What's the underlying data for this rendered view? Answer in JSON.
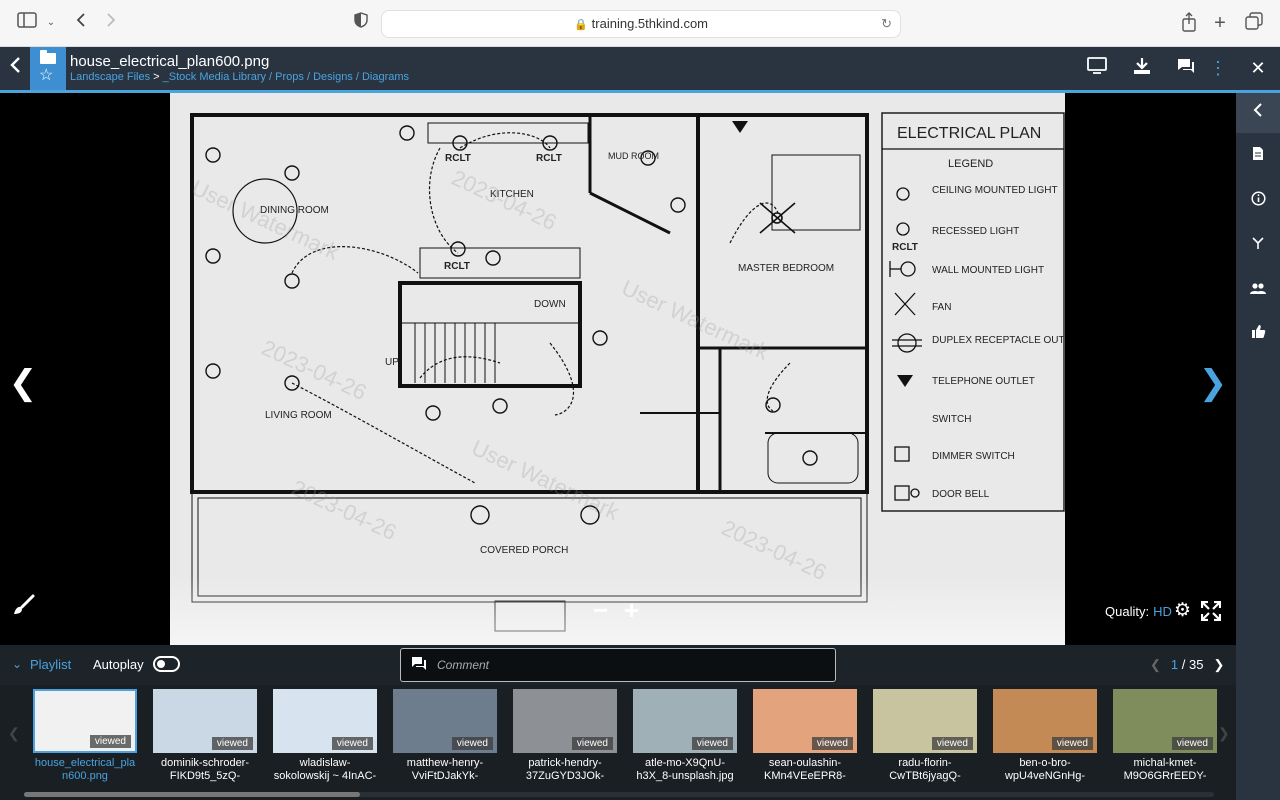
{
  "browser": {
    "url": "training.5thkind.com",
    "icons": [
      "sidebar-icon",
      "chevron-down-icon",
      "back-icon",
      "forward-icon",
      "shield-icon",
      "lock-icon",
      "reload-icon",
      "share-icon",
      "plus-icon",
      "tabs-icon"
    ]
  },
  "header": {
    "file_name": "house_electrical_plan600.png",
    "breadcrumb_root": "Landscape Files",
    "breadcrumb_sep": ">",
    "breadcrumb_path": "_Stock Media Library / Props / Designs / Diagrams",
    "icons": [
      "monitor-icon",
      "download-icon",
      "comments-icon",
      "more-icon",
      "close-icon"
    ]
  },
  "rail": {
    "icons": [
      "collapse-icon",
      "document-icon",
      "info-icon",
      "branch-icon",
      "users-icon",
      "like-icon"
    ]
  },
  "plan": {
    "title": "ELECTRICAL PLAN",
    "legend_title": "LEGEND",
    "legend": [
      "CEILING MOUNTED LIGHT",
      "RECESSED LIGHT",
      "WALL MOUNTED LIGHT",
      "FAN",
      "DUPLEX RECEPTACLE OUTLET",
      "TELEPHONE OUTLET",
      "SWITCH",
      "DIMMER SWITCH",
      "DOOR BELL"
    ],
    "rooms": [
      "DINING ROOM",
      "KITCHEN",
      "MUD ROOM",
      "MASTER BEDROOM",
      "LIVING ROOM",
      "COVERED PORCH"
    ],
    "stair_down": "DOWN",
    "stair_up": "UP",
    "rclt": "RCLT",
    "watermark_date": "2023-04-26",
    "watermark_user": "User Watermark"
  },
  "viewer": {
    "prev": "❮",
    "next": "❯",
    "zoom_out": "−",
    "zoom_in": "+",
    "quality_label": "Quality:",
    "quality_value": "HD"
  },
  "controls": {
    "playlist": "Playlist",
    "autoplay": "Autoplay",
    "comment_placeholder": "Comment",
    "page_current": "1",
    "page_total": "/ 35"
  },
  "thumbnails": [
    {
      "label1": "house_electrical_pla",
      "label2": "n600.png",
      "viewed": "viewed",
      "bg": "#f1f1f1"
    },
    {
      "label1": "dominik-schroder-",
      "label2": "FIKD9t5_5zQ-",
      "viewed": "viewed",
      "bg": "#c9d8e4"
    },
    {
      "label1": "wladislaw-",
      "label2": "sokolowskij ~ 4InAC-",
      "viewed": "viewed",
      "bg": "#d7e4ef"
    },
    {
      "label1": "matthew-henry-",
      "label2": "VviFtDJakYk-",
      "viewed": "viewed",
      "bg": "#6e7d8e"
    },
    {
      "label1": "patrick-hendry-",
      "label2": "37ZuGYD3JOk-",
      "viewed": "viewed",
      "bg": "#8d9196"
    },
    {
      "label1": "atle-mo-X9QnU-",
      "label2": "h3X_8-unsplash.jpg",
      "viewed": "viewed",
      "bg": "#9fb0b7"
    },
    {
      "label1": "sean-oulashin-",
      "label2": "KMn4VEeEPR8-",
      "viewed": "viewed",
      "bg": "#e3a47d"
    },
    {
      "label1": "radu-florin-",
      "label2": "CwTBt6jyagQ-",
      "viewed": "viewed",
      "bg": "#c9c4a0"
    },
    {
      "label1": "ben-o-bro-",
      "label2": "wpU4veNGnHg-",
      "viewed": "viewed",
      "bg": "#c38a55"
    },
    {
      "label1": "michal-kmet-",
      "label2": "M9O6GRrEEDY-",
      "viewed": "viewed",
      "bg": "#7f8d5c"
    }
  ],
  "colors": {
    "accent": "#4aa3df",
    "header": "#2a3440",
    "active_thumb_border": "#4aa3df"
  }
}
